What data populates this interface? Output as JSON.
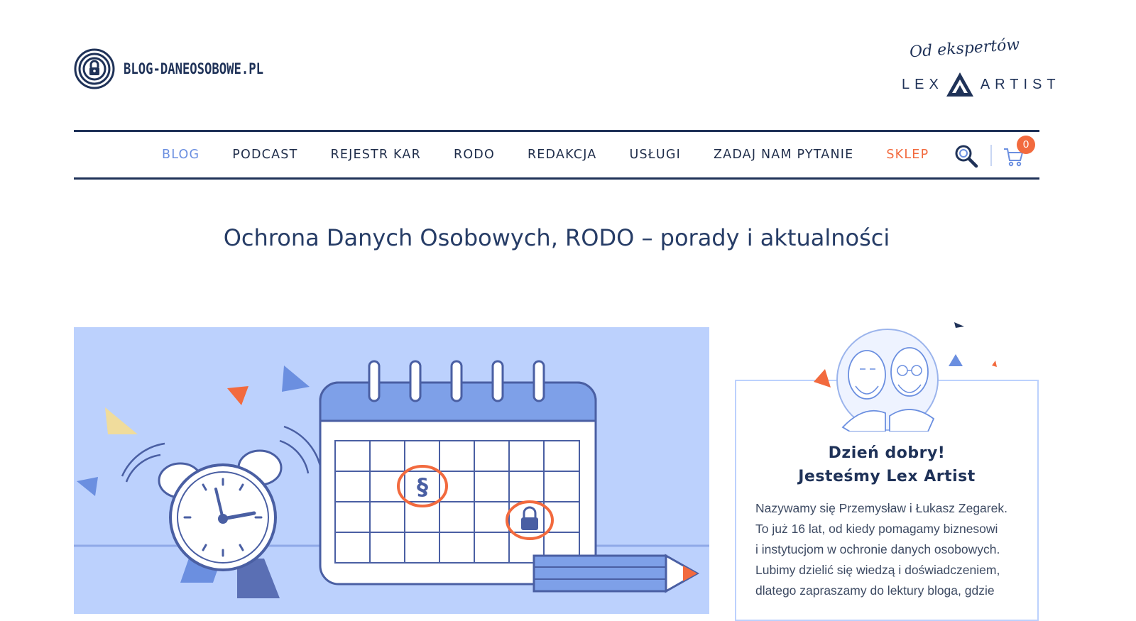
{
  "header": {
    "site_name": "BLOG-DANEOSOBOWE.PL",
    "partner_tagline": "Od ekspertów",
    "partner_brand_left": "LEX",
    "partner_brand_right": "ARTIST"
  },
  "nav": {
    "items": [
      {
        "label": "BLOG"
      },
      {
        "label": "PODCAST"
      },
      {
        "label": "REJESTR KAR"
      },
      {
        "label": "RODO"
      },
      {
        "label": "REDAKCJA"
      },
      {
        "label": "USŁUGI"
      },
      {
        "label": "ZADAJ NAM PYTANIE"
      },
      {
        "label": "SKLEP"
      }
    ],
    "cart_count": "0",
    "search_icon": "search-icon",
    "cart_icon": "cart-icon"
  },
  "page": {
    "title": "Ochrona Danych Osobowych, RODO – porady i aktualności"
  },
  "sidebar": {
    "heading_line1": "Dzień dobry!",
    "heading_line2": "Jesteśmy Lex Artist",
    "body_lines": [
      "Nazywamy się Przemysław i Łukasz Zegarek.",
      "To już 16 lat, od kiedy pomagamy biznesowi",
      "i instytucjom w ochronie danych osobowych.",
      "Lubimy dzielić się wiedzą i doświadczeniem,",
      "dlatego zapraszamy do lektury bloga, gdzie"
    ]
  },
  "colors": {
    "navy": "#1f3258",
    "accent_blue": "#6b8fe0",
    "accent_orange": "#f26a3e",
    "hero_bg": "#bcd1fd"
  }
}
